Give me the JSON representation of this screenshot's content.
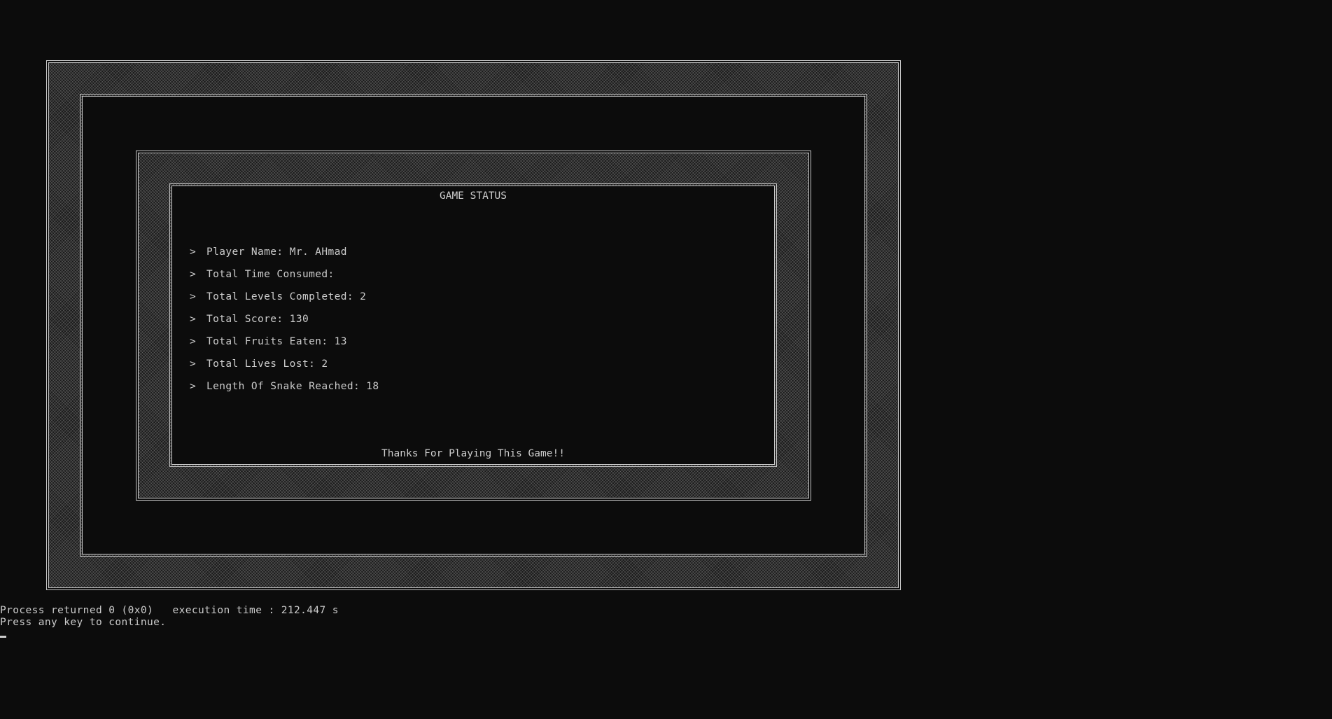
{
  "screen": {
    "title": "GAME STATUS",
    "stats": [
      {
        "marker": ">",
        "label": "Player Name: ",
        "value": "Mr. AHmad"
      },
      {
        "marker": ">",
        "label": "Total Time Consumed: ",
        "value": ""
      },
      {
        "marker": ">",
        "label": "Total Levels Completed: ",
        "value": "2"
      },
      {
        "marker": ">",
        "label": "Total Score: ",
        "value": "130"
      },
      {
        "marker": ">",
        "label": "Total Fruits Eaten: ",
        "value": "13"
      },
      {
        "marker": ">",
        "label": "Total Lives Lost: ",
        "value": "2"
      },
      {
        "marker": ">",
        "label": "Length Of Snake Reached: ",
        "value": "18"
      }
    ],
    "footer": "Thanks For Playing This Game!!"
  },
  "console": {
    "process_line": "Process returned 0 (0x0)   execution time : 212.447 s",
    "prompt_line": "Press any key to continue."
  },
  "colors": {
    "background": "#0c0c0c",
    "text": "#cccccc",
    "frame": "#c8c8c8"
  }
}
